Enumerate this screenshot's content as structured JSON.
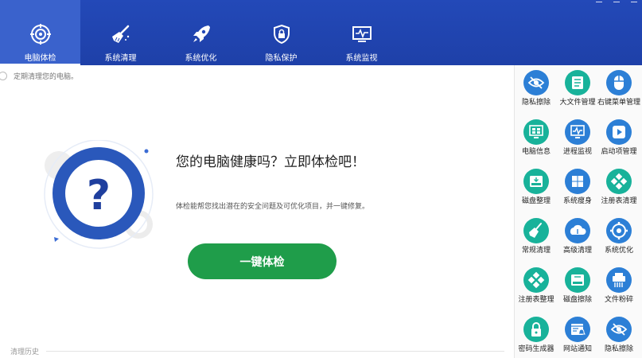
{
  "nav": {
    "tabs": [
      {
        "label": "电脑体检",
        "icon": "target-icon",
        "active": true
      },
      {
        "label": "系统清理",
        "icon": "broom-icon",
        "active": false
      },
      {
        "label": "系统优化",
        "icon": "rocket-icon",
        "active": false
      },
      {
        "label": "隐私保护",
        "icon": "shield-lock-icon",
        "active": false
      },
      {
        "label": "系统监视",
        "icon": "monitor-pulse-icon",
        "active": false
      }
    ]
  },
  "main": {
    "auto_clean_label": "定期清理您的电脑。",
    "headline": "您的电脑健康吗？立即体检吧！",
    "description": "体检能帮您找出潜在的安全问题及可优化项目，并一键修复。",
    "check_button": "一键体检",
    "history_label": "清理历史"
  },
  "sidebar": {
    "tools": [
      {
        "label": "隐私擦除",
        "icon": "eye-off-icon",
        "color": "#2c7fd6"
      },
      {
        "label": "大文件管理",
        "icon": "file-list-icon",
        "color": "#18b29a"
      },
      {
        "label": "右键菜单管理",
        "icon": "mouse-icon",
        "color": "#2c7fd6"
      },
      {
        "label": "电脑信息",
        "icon": "grid-monitor-icon",
        "color": "#18b29a"
      },
      {
        "label": "进程监视",
        "icon": "process-monitor-icon",
        "color": "#2c7fd6"
      },
      {
        "label": "启动项管理",
        "icon": "play-icon",
        "color": "#2c7fd6"
      },
      {
        "label": "磁盘整理",
        "icon": "disk-icon",
        "color": "#18b29a"
      },
      {
        "label": "系统瘦身",
        "icon": "windows-icon",
        "color": "#2c7fd6"
      },
      {
        "label": "注册表清理",
        "icon": "registry-icon",
        "color": "#18b29a"
      },
      {
        "label": "常规清理",
        "icon": "broom-icon",
        "color": "#18b29a"
      },
      {
        "label": "高级清理",
        "icon": "cloud-clean-icon",
        "color": "#2c7fd6"
      },
      {
        "label": "系统优化",
        "icon": "gear-icon",
        "color": "#2c7fd6"
      },
      {
        "label": "注册表整理",
        "icon": "registry-icon",
        "color": "#18b29a"
      },
      {
        "label": "磁盘擦除",
        "icon": "disk-icon",
        "color": "#18b29a"
      },
      {
        "label": "文件粉碎",
        "icon": "shredder-icon",
        "color": "#2c7fd6"
      },
      {
        "label": "密码生成器",
        "icon": "lock-icon",
        "color": "#18b29a"
      },
      {
        "label": "网站通知",
        "icon": "web-bell-icon",
        "color": "#2c7fd6"
      },
      {
        "label": "隐私擦除",
        "icon": "eye-off-icon",
        "color": "#2c7fd6"
      }
    ]
  }
}
